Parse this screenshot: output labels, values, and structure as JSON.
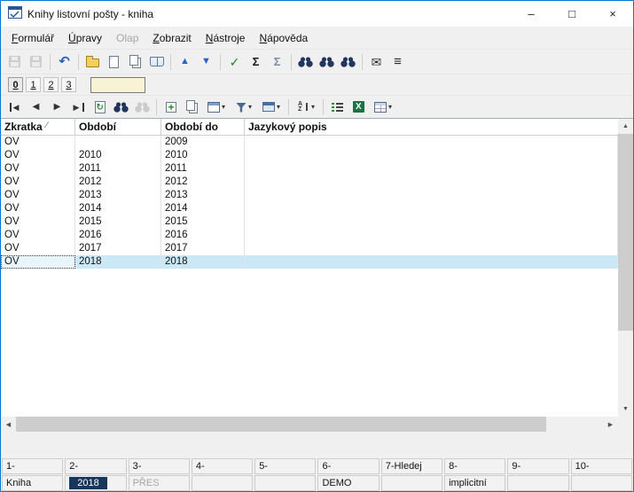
{
  "window": {
    "title": "Knihy listovní pošty - kniha",
    "minimize": "–",
    "maximize": "□",
    "close": "×"
  },
  "menu": [
    {
      "key": "formular",
      "label": "Formulář",
      "underline": 0,
      "enabled": true
    },
    {
      "key": "upravy",
      "label": "Úpravy",
      "underline": 0,
      "enabled": true
    },
    {
      "key": "olap",
      "label": "Olap",
      "underline": -1,
      "enabled": false
    },
    {
      "key": "zobrazit",
      "label": "Zobrazit",
      "underline": 0,
      "enabled": true
    },
    {
      "key": "nastroje",
      "label": "Nástroje",
      "underline": 0,
      "enabled": true
    },
    {
      "key": "napoveda",
      "label": "Nápověda",
      "underline": 0,
      "enabled": true
    }
  ],
  "icons": {
    "dropdown": "▾",
    "scroll_up": "▲",
    "scroll_down": "▼",
    "scroll_left": "◀",
    "scroll_right": "▶"
  },
  "toolbar_main": [
    {
      "button": "save-button",
      "icon": "save-icon",
      "kind": "floppy",
      "enabled": false
    },
    {
      "button": "save-close-button",
      "icon": "save-close-icon",
      "kind": "floppy",
      "enabled": false
    },
    {
      "sep": true
    },
    {
      "button": "undo-button",
      "icon": "undo-icon",
      "kind": "glyph",
      "glyph": "↶",
      "color": "#1f5fc0",
      "size": 15,
      "bold": true
    },
    {
      "sep": true
    },
    {
      "button": "open-button",
      "icon": "open-folder-icon",
      "kind": "folder"
    },
    {
      "button": "new-record-button",
      "icon": "new-page-icon",
      "kind": "page"
    },
    {
      "button": "copy-button",
      "icon": "copy-pages-icon",
      "kind": "pages"
    },
    {
      "button": "book-button",
      "icon": "book-icon",
      "kind": "book"
    },
    {
      "sep": true
    },
    {
      "button": "move-up-button",
      "icon": "arrow-up-icon",
      "kind": "glyph",
      "glyph": "▲",
      "color": "#2b62c2",
      "size": 11
    },
    {
      "button": "move-down-button",
      "icon": "arrow-down-icon",
      "kind": "glyph",
      "glyph": "▼",
      "color": "#2b62c2",
      "size": 11
    },
    {
      "sep": true
    },
    {
      "button": "confirm-button",
      "icon": "check-icon",
      "kind": "glyph",
      "glyph": "✓",
      "color": "#18871b",
      "size": 14,
      "bold": true
    },
    {
      "button": "sum-button",
      "icon": "sigma-icon",
      "kind": "glyph",
      "glyph": "Σ",
      "color": "#1a1a1a",
      "size": 13,
      "bold": true
    },
    {
      "button": "sum-filtered-button",
      "icon": "sigma-gray-icon",
      "kind": "glyph",
      "glyph": "Σ",
      "color": "#7d8fa5",
      "size": 13,
      "bold": true
    },
    {
      "sep": true
    },
    {
      "button": "find-button",
      "icon": "binoculars-icon",
      "kind": "binoc"
    },
    {
      "button": "find-add-button",
      "icon": "binoculars-plus-icon",
      "kind": "binoc"
    },
    {
      "button": "find-next-button",
      "icon": "binoculars-next-icon",
      "kind": "binoc"
    },
    {
      "sep": true
    },
    {
      "button": "mail-button",
      "icon": "envelope-icon",
      "kind": "glyph",
      "glyph": "✉",
      "color": "#2a2a2a",
      "size": 14
    },
    {
      "button": "list-menu-button",
      "icon": "hamburger-icon",
      "kind": "glyph",
      "glyph": "≡",
      "color": "#2a2a2a",
      "size": 15,
      "bold": true
    }
  ],
  "toolbar_nav": [
    {
      "button": "first-record-button",
      "icon": "first-record-icon",
      "kind": "nav-first"
    },
    {
      "button": "prev-record-button",
      "icon": "prev-record-icon",
      "kind": "glyph",
      "glyph": "◀",
      "color": "#333333",
      "size": 10
    },
    {
      "button": "next-record-button",
      "icon": "next-record-icon",
      "kind": "glyph",
      "glyph": "▶",
      "color": "#333333",
      "size": 10
    },
    {
      "button": "last-record-button",
      "icon": "last-record-icon",
      "kind": "nav-last"
    },
    {
      "button": "refresh-button",
      "icon": "refresh-icon",
      "kind": "refresh"
    },
    {
      "button": "search-button",
      "icon": "search-binoculars-icon",
      "kind": "binoc"
    },
    {
      "button": "search-column-button",
      "icon": "search-gray-icon",
      "kind": "binoc-gray",
      "enabled": false
    },
    {
      "sep": true
    },
    {
      "button": "insert-record-button",
      "icon": "insert-record-icon",
      "kind": "insert"
    },
    {
      "button": "copy-record-button",
      "icon": "copy-record-icon",
      "kind": "pages"
    },
    {
      "button": "record-actions-button",
      "icon": "record-icon",
      "kind": "record",
      "dropdown": true
    },
    {
      "button": "filter-button",
      "icon": "filter-funnel-icon",
      "kind": "funnel",
      "dropdown": true
    },
    {
      "button": "view-options-button",
      "icon": "view-window-icon",
      "kind": "window",
      "dropdown": true
    },
    {
      "sep": true
    },
    {
      "button": "sort-button",
      "icon": "sort-az-icon",
      "kind": "sort",
      "dropdown": true
    },
    {
      "sep": true
    },
    {
      "button": "value-list-button",
      "icon": "value-list-icon",
      "kind": "enum"
    },
    {
      "button": "excel-export-button",
      "icon": "excel-icon",
      "kind": "excel"
    },
    {
      "button": "columns-button",
      "icon": "table-grid-icon",
      "kind": "grid",
      "dropdown": true
    }
  ],
  "tabs": {
    "items": [
      "0",
      "1",
      "2",
      "3"
    ],
    "active": "0",
    "quick_input_value": ""
  },
  "grid": {
    "columns": [
      {
        "label": "Zkratka",
        "sort_indicator": "∕"
      },
      {
        "label": "Období"
      },
      {
        "label": "Období do"
      },
      {
        "label": "Jazykový popis"
      }
    ],
    "rows": [
      {
        "cells": [
          "OV",
          "",
          "2009",
          ""
        ]
      },
      {
        "cells": [
          "OV",
          "2010",
          "2010",
          ""
        ]
      },
      {
        "cells": [
          "OV",
          "2011",
          "2011",
          ""
        ]
      },
      {
        "cells": [
          "OV",
          "2012",
          "2012",
          ""
        ]
      },
      {
        "cells": [
          "OV",
          "2013",
          "2013",
          ""
        ]
      },
      {
        "cells": [
          "OV",
          "2014",
          "2014",
          ""
        ]
      },
      {
        "cells": [
          "OV",
          "2015",
          "2015",
          ""
        ]
      },
      {
        "cells": [
          "OV",
          "2016",
          "2016",
          ""
        ]
      },
      {
        "cells": [
          "OV",
          "2017",
          "2017",
          ""
        ]
      },
      {
        "cells": [
          "OV",
          "2018",
          "2018",
          ""
        ],
        "selected": true
      }
    ]
  },
  "statusbar": {
    "row1": [
      "1-",
      "2-",
      "3-",
      "4-",
      "5-",
      "6-",
      "7-Hledej",
      "8-",
      "9-",
      "10-"
    ],
    "row2": [
      {
        "text": "Kniha",
        "style": "normal"
      },
      {
        "text": "2018",
        "style": "highlight"
      },
      {
        "text": "PŘES",
        "style": "disabled"
      },
      {
        "text": "",
        "style": "normal"
      },
      {
        "text": "",
        "style": "normal"
      },
      {
        "text": "DEMO",
        "style": "normal"
      },
      {
        "text": "",
        "style": "normal"
      },
      {
        "text": "implicitní",
        "style": "normal"
      },
      {
        "text": "",
        "style": "normal"
      },
      {
        "text": "",
        "style": "normal"
      }
    ]
  },
  "colors": {
    "window_border": "#0078d7",
    "selection_row": "#cbe8f6",
    "status_highlight_bg": "#17365d",
    "quick_input_bg": "#f8f3d4"
  }
}
